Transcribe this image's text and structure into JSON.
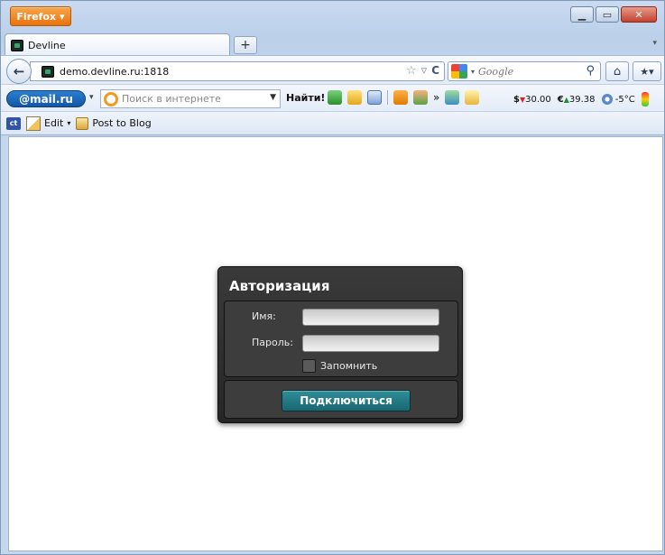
{
  "browser": {
    "menu_button": "Firefox",
    "tab_title": "Devline",
    "new_tab": "+",
    "url": "demo.devline.ru:1818",
    "search_placeholder": "Google"
  },
  "mailru_toolbar": {
    "logo": "@mail.ru",
    "search_placeholder": "Поиск в интернете",
    "find_button": "Найти!",
    "usd": "$",
    "usd_value": "30.00",
    "eur": "€",
    "eur_value": "39.38",
    "weather": "-5°C"
  },
  "bookmarks": {
    "ct_label": "ct",
    "edit": "Edit",
    "post": "Post to Blog"
  },
  "login": {
    "title": "Авторизация",
    "name_label": "Имя:",
    "name_value": "",
    "password_label": "Пароль:",
    "password_value": "",
    "remember_label": "Запомнить",
    "remember_checked": false,
    "connect_button": "Подключиться"
  },
  "colors": {
    "firefox_orange": "#e8720c",
    "connect_button": "#1f7680",
    "dialog_bg": "#2f2f2f"
  }
}
